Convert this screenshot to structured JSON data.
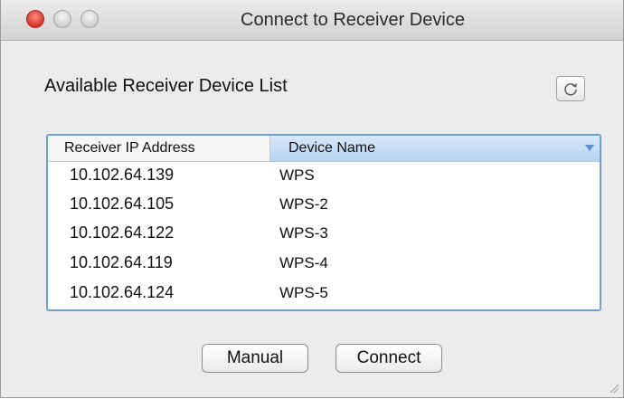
{
  "window": {
    "title": "Connect to Receiver Device"
  },
  "section": {
    "label": "Available Receiver Device List"
  },
  "toolbar": {
    "refresh_icon": "refresh-icon"
  },
  "table": {
    "columns": [
      "Receiver IP Address",
      "Device Name"
    ],
    "rows": [
      [
        "10.102.64.139",
        "WPS"
      ],
      [
        "10.102.64.105",
        "WPS-2"
      ],
      [
        "10.102.64.122",
        "WPS-3"
      ],
      [
        "10.102.64.119",
        "WPS-4"
      ],
      [
        "10.102.64.124",
        "WPS-5"
      ]
    ]
  },
  "buttons": {
    "manual": "Manual",
    "connect": "Connect"
  },
  "colors": {
    "accent": "#6e9fd4",
    "close": "#d9342b"
  }
}
